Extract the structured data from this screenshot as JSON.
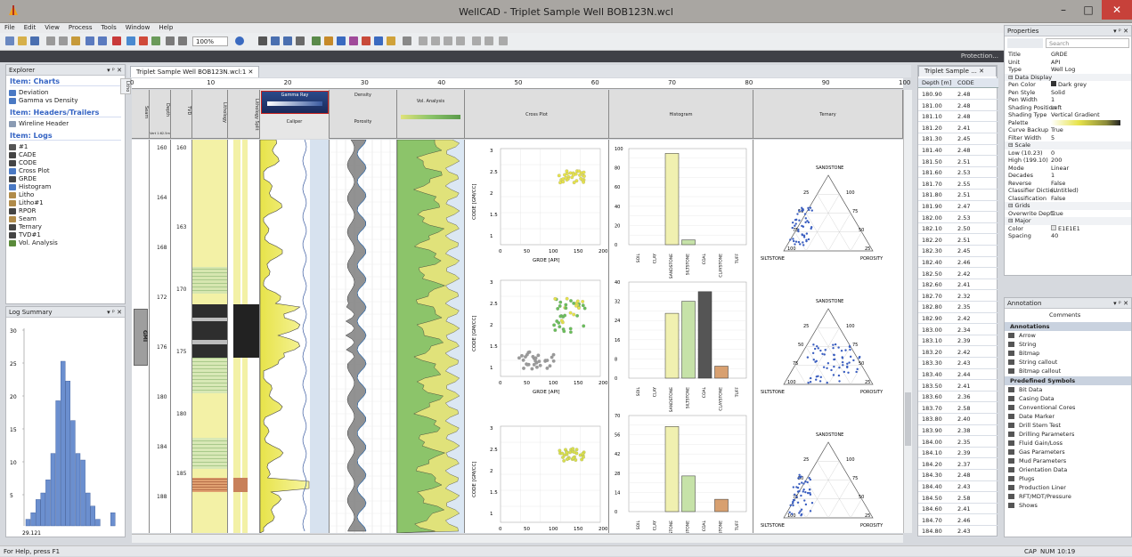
{
  "window": {
    "title": "WellCAD - Triplet Sample Well BOB123N.wcl",
    "minimize": "–",
    "maximize": "□",
    "close": "✕"
  },
  "menu": [
    "File",
    "Edit",
    "View",
    "Process",
    "Tools",
    "Window",
    "Help"
  ],
  "toolbar": {
    "zoom": "100%"
  },
  "ribbon": {
    "protection": "Protection..."
  },
  "explorer": {
    "title": "Explorer",
    "sections": [
      {
        "title": "Item: Charts",
        "items": [
          {
            "label": "Deviation",
            "color": "#4a79c4"
          },
          {
            "label": "Gamma vs Density",
            "color": "#4a79c4"
          }
        ]
      },
      {
        "title": "Item: Headers/Trailers",
        "items": [
          {
            "label": "Wireline Header",
            "color": "#8a9bb3"
          }
        ]
      },
      {
        "title": "Item: Logs",
        "items": [
          {
            "label": "#1",
            "color": "#555"
          },
          {
            "label": "CADE",
            "color": "#444"
          },
          {
            "label": "CODE",
            "color": "#444"
          },
          {
            "label": "Cross Plot",
            "color": "#4a79c4"
          },
          {
            "label": "GRDE",
            "color": "#444"
          },
          {
            "label": "Histogram",
            "color": "#4a79c4"
          },
          {
            "label": "Litho",
            "color": "#b08b4a"
          },
          {
            "label": "Litho#1",
            "color": "#b08b4a"
          },
          {
            "label": "RPOR",
            "color": "#444"
          },
          {
            "label": "Seam",
            "color": "#b08b4a"
          },
          {
            "label": "Ternary",
            "color": "#444"
          },
          {
            "label": "TVD#1",
            "color": "#444"
          },
          {
            "label": "Vol. Analysis",
            "color": "#5a8a3a"
          }
        ]
      }
    ]
  },
  "log_summary": {
    "title": "Log Summary",
    "y_ticks": [
      "30",
      "25",
      "20",
      "15",
      "10",
      "5"
    ],
    "x_label": "29.121"
  },
  "doc": {
    "tab": "Triplet Sample Well BOB123N.wcl:1",
    "ruler": [
      "0",
      "10",
      "20",
      "30",
      "40",
      "50",
      "60",
      "70",
      "80",
      "90",
      "100"
    ],
    "headers": {
      "seam": "Seam",
      "depth": "Depth",
      "depth_unit": "Vert 1:62.5m",
      "tvd": "TVD",
      "lithology": "Lithology",
      "lith_split": "Lithology Split",
      "gamma": "Gamma Ray",
      "caliper": "Caliper",
      "density": "Density",
      "porosity": "Porosity",
      "vol": "Vol. Analysis",
      "cross": "Cross Plot",
      "histo": "Histogram",
      "ternary": "Ternary"
    },
    "depths": [
      "160",
      "164",
      "168",
      "172",
      "176",
      "180",
      "184",
      "188"
    ],
    "tvds": [
      "160",
      "163",
      "170",
      "175",
      "180",
      "185"
    ],
    "seam": "GMI"
  },
  "charts": {
    "cross": {
      "ylabel": "CODE [GM/CC]",
      "xlabel": "GRDE [API]",
      "xticks": [
        "0",
        "50",
        "100",
        "150",
        "200"
      ]
    },
    "histo_cats": [
      "SOIL",
      "CLAY",
      "SANDSTONE",
      "SILTSTONE",
      "COAL",
      "CLAYSTONE",
      "TUFF"
    ],
    "ternary": {
      "top": "SANDSTONE",
      "left": "SILTSTONE",
      "right": "POROSITY",
      "ticks": [
        "25",
        "50",
        "75",
        "100"
      ]
    }
  },
  "depth_table": {
    "tab": "Triplet Sample ...",
    "col1": "Depth [m]",
    "col2": "CODE",
    "rows": [
      [
        "180.90",
        "2.48"
      ],
      [
        "181.00",
        "2.48"
      ],
      [
        "181.10",
        "2.48"
      ],
      [
        "181.20",
        "2.41"
      ],
      [
        "181.30",
        "2.45"
      ],
      [
        "181.40",
        "2.48"
      ],
      [
        "181.50",
        "2.51"
      ],
      [
        "181.60",
        "2.53"
      ],
      [
        "181.70",
        "2.55"
      ],
      [
        "181.80",
        "2.51"
      ],
      [
        "181.90",
        "2.47"
      ],
      [
        "182.00",
        "2.53"
      ],
      [
        "182.10",
        "2.50"
      ],
      [
        "182.20",
        "2.51"
      ],
      [
        "182.30",
        "2.45"
      ],
      [
        "182.40",
        "2.46"
      ],
      [
        "182.50",
        "2.42"
      ],
      [
        "182.60",
        "2.41"
      ],
      [
        "182.70",
        "2.32"
      ],
      [
        "182.80",
        "2.35"
      ],
      [
        "182.90",
        "2.42"
      ],
      [
        "183.00",
        "2.34"
      ],
      [
        "183.10",
        "2.39"
      ],
      [
        "183.20",
        "2.42"
      ],
      [
        "183.30",
        "2.43"
      ],
      [
        "183.40",
        "2.44"
      ],
      [
        "183.50",
        "2.41"
      ],
      [
        "183.60",
        "2.36"
      ],
      [
        "183.70",
        "2.58"
      ],
      [
        "183.80",
        "2.40"
      ],
      [
        "183.90",
        "2.38"
      ],
      [
        "184.00",
        "2.35"
      ],
      [
        "184.10",
        "2.39"
      ],
      [
        "184.20",
        "2.37"
      ],
      [
        "184.30",
        "2.48"
      ],
      [
        "184.40",
        "2.43"
      ],
      [
        "184.50",
        "2.58"
      ],
      [
        "184.60",
        "2.41"
      ],
      [
        "184.70",
        "2.46"
      ],
      [
        "184.80",
        "2.43"
      ]
    ]
  },
  "properties": {
    "title": "Properties",
    "search": "Search",
    "rows": [
      [
        "Title",
        "GRDE"
      ],
      [
        "Unit",
        "API"
      ],
      [
        "Type",
        "Well Log"
      ],
      [
        "⊟ Data Display",
        ""
      ],
      [
        "Pen Color",
        "Dark grey"
      ],
      [
        "Pen Style",
        "Solid"
      ],
      [
        "Pen Width",
        "1"
      ],
      [
        "Shading Position",
        "Left"
      ],
      [
        "Shading Type",
        "Vertical Gradient"
      ],
      [
        "Palette",
        ""
      ],
      [
        "Curve Backup",
        "True"
      ],
      [
        "Filter Width",
        "5"
      ],
      [
        "⊟ Scale",
        ""
      ],
      [
        "Low (10.23)",
        "0"
      ],
      [
        "High (199.10)",
        "200"
      ],
      [
        "Mode",
        "Linear"
      ],
      [
        "Decades",
        "1"
      ],
      [
        "Reverse",
        "False"
      ],
      [
        "Classifier Dictio...",
        "(Untitled)"
      ],
      [
        "Classification",
        "False"
      ],
      [
        "⊟ Grids",
        ""
      ],
      [
        "Overwrite Dept...",
        "True"
      ],
      [
        "⊟ Major",
        ""
      ],
      [
        "Color",
        "E1E1E1"
      ],
      [
        "Spacing",
        "40"
      ]
    ]
  },
  "annotation": {
    "title": "Annotation",
    "dropdown": "Comments",
    "annotations_head": "Annotations",
    "annotations": [
      "Arrow",
      "String",
      "Bitmap",
      "String callout",
      "Bitmap callout"
    ],
    "symbols_head": "Predefined Symbols",
    "symbols": [
      "Bit Data",
      "Casing Data",
      "Conventional Cores",
      "Date Marker",
      "Drill Stem Test",
      "Drilling Parameters",
      "Fluid Gain/Loss",
      "Gas Parameters",
      "Mud Parameters",
      "Orientation Data",
      "Plugs",
      "Production Liner",
      "RFT/MDT/Pressure",
      "Shows"
    ]
  },
  "status": {
    "help": "For Help, press F1",
    "cap": "CAP",
    "num": "NUM",
    "time": "10:19"
  }
}
